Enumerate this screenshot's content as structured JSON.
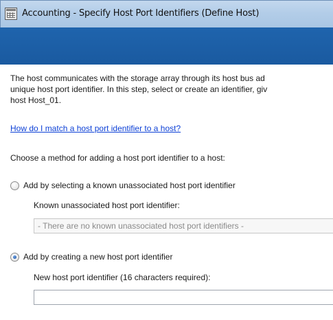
{
  "window": {
    "title": "Accounting - Specify Host Port Identifiers (Define Host)"
  },
  "content": {
    "description_lines": [
      "The host communicates with the storage array through its host bus ad",
      "unique host port identifier. In this step, select or create an identifier, giv",
      "host Host_01."
    ],
    "help_link": "How do I match a host port identifier to a host?",
    "method_prompt": "Choose a method for adding a host port identifier to a host:",
    "option_known": {
      "label": "Add by selecting a known unassociated host port identifier",
      "checked": false,
      "field_label": "Known unassociated host port identifier:",
      "select_value": "- There are no known unassociated host port identifiers -"
    },
    "option_new": {
      "label": "Add by creating a new host port identifier",
      "checked": true,
      "field_label": "New host port identifier (16 characters required):",
      "input_value": ""
    }
  },
  "icons": {
    "app": "host-grid-icon"
  }
}
